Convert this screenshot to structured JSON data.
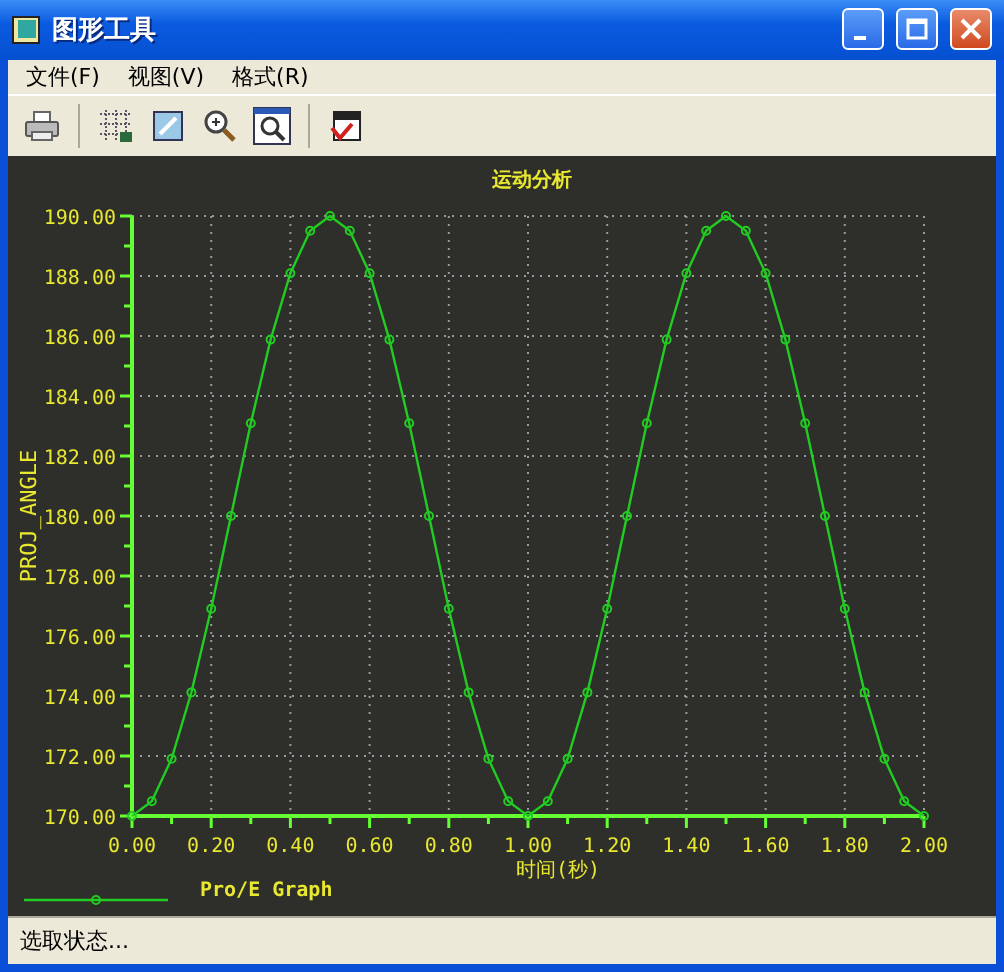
{
  "window": {
    "title": "图形工具"
  },
  "menu": [
    "文件(F)",
    "视图(V)",
    "格式(R)"
  ],
  "chart_data": {
    "type": "line",
    "title": "运动分析",
    "xlabel": "时间(秒)",
    "ylabel": "PROJ_ANGLE",
    "x": [
      0,
      0.05,
      0.1,
      0.15,
      0.2,
      0.25,
      0.3,
      0.35,
      0.4,
      0.45,
      0.5,
      0.55,
      0.6,
      0.65,
      0.7,
      0.75,
      0.8,
      0.85,
      0.9,
      0.95,
      1,
      1.05,
      1.1,
      1.15,
      1.2,
      1.25,
      1.3,
      1.35,
      1.4,
      1.45,
      1.5,
      1.55,
      1.6,
      1.65,
      1.7,
      1.75,
      1.8,
      1.85,
      1.9,
      1.95,
      2
    ],
    "series": [
      {
        "name": "Pro/E Graph",
        "color": "#22cc22",
        "marker": "circle",
        "values": [
          170,
          170.49,
          171.91,
          174.12,
          176.91,
          180,
          183.09,
          185.88,
          188.09,
          189.51,
          190,
          189.51,
          188.09,
          185.88,
          183.09,
          180,
          176.91,
          174.12,
          171.91,
          170.49,
          170,
          170.49,
          171.91,
          174.12,
          176.91,
          180,
          183.09,
          185.88,
          188.09,
          189.51,
          190,
          189.51,
          188.09,
          185.88,
          183.09,
          180,
          176.91,
          174.12,
          171.91,
          170.49,
          170
        ]
      }
    ],
    "grid": true,
    "xlim": [
      0,
      2
    ],
    "ylim": [
      170,
      190
    ],
    "xticks": [
      {
        "value": 0,
        "label": "0.00"
      },
      {
        "value": 0.2,
        "label": "0.20"
      },
      {
        "value": 0.4,
        "label": "0.40"
      },
      {
        "value": 0.6,
        "label": "0.60"
      },
      {
        "value": 0.8,
        "label": "0.80"
      },
      {
        "value": 1,
        "label": "1.00"
      },
      {
        "value": 1.2,
        "label": "1.20"
      },
      {
        "value": 1.4,
        "label": "1.40"
      },
      {
        "value": 1.6,
        "label": "1.60"
      },
      {
        "value": 1.8,
        "label": "1.80"
      },
      {
        "value": 2,
        "label": "2.00"
      }
    ],
    "yticks": [
      {
        "value": 170,
        "label": "170.00"
      },
      {
        "value": 172,
        "label": "172.00"
      },
      {
        "value": 174,
        "label": "174.00"
      },
      {
        "value": 176,
        "label": "176.00"
      },
      {
        "value": 178,
        "label": "178.00"
      },
      {
        "value": 180,
        "label": "180.00"
      },
      {
        "value": 182,
        "label": "182.00"
      },
      {
        "value": 184,
        "label": "184.00"
      },
      {
        "value": 186,
        "label": "186.00"
      },
      {
        "value": 188,
        "label": "188.00"
      },
      {
        "value": 190,
        "label": "190.00"
      }
    ]
  },
  "status_bar": "选取状态..."
}
